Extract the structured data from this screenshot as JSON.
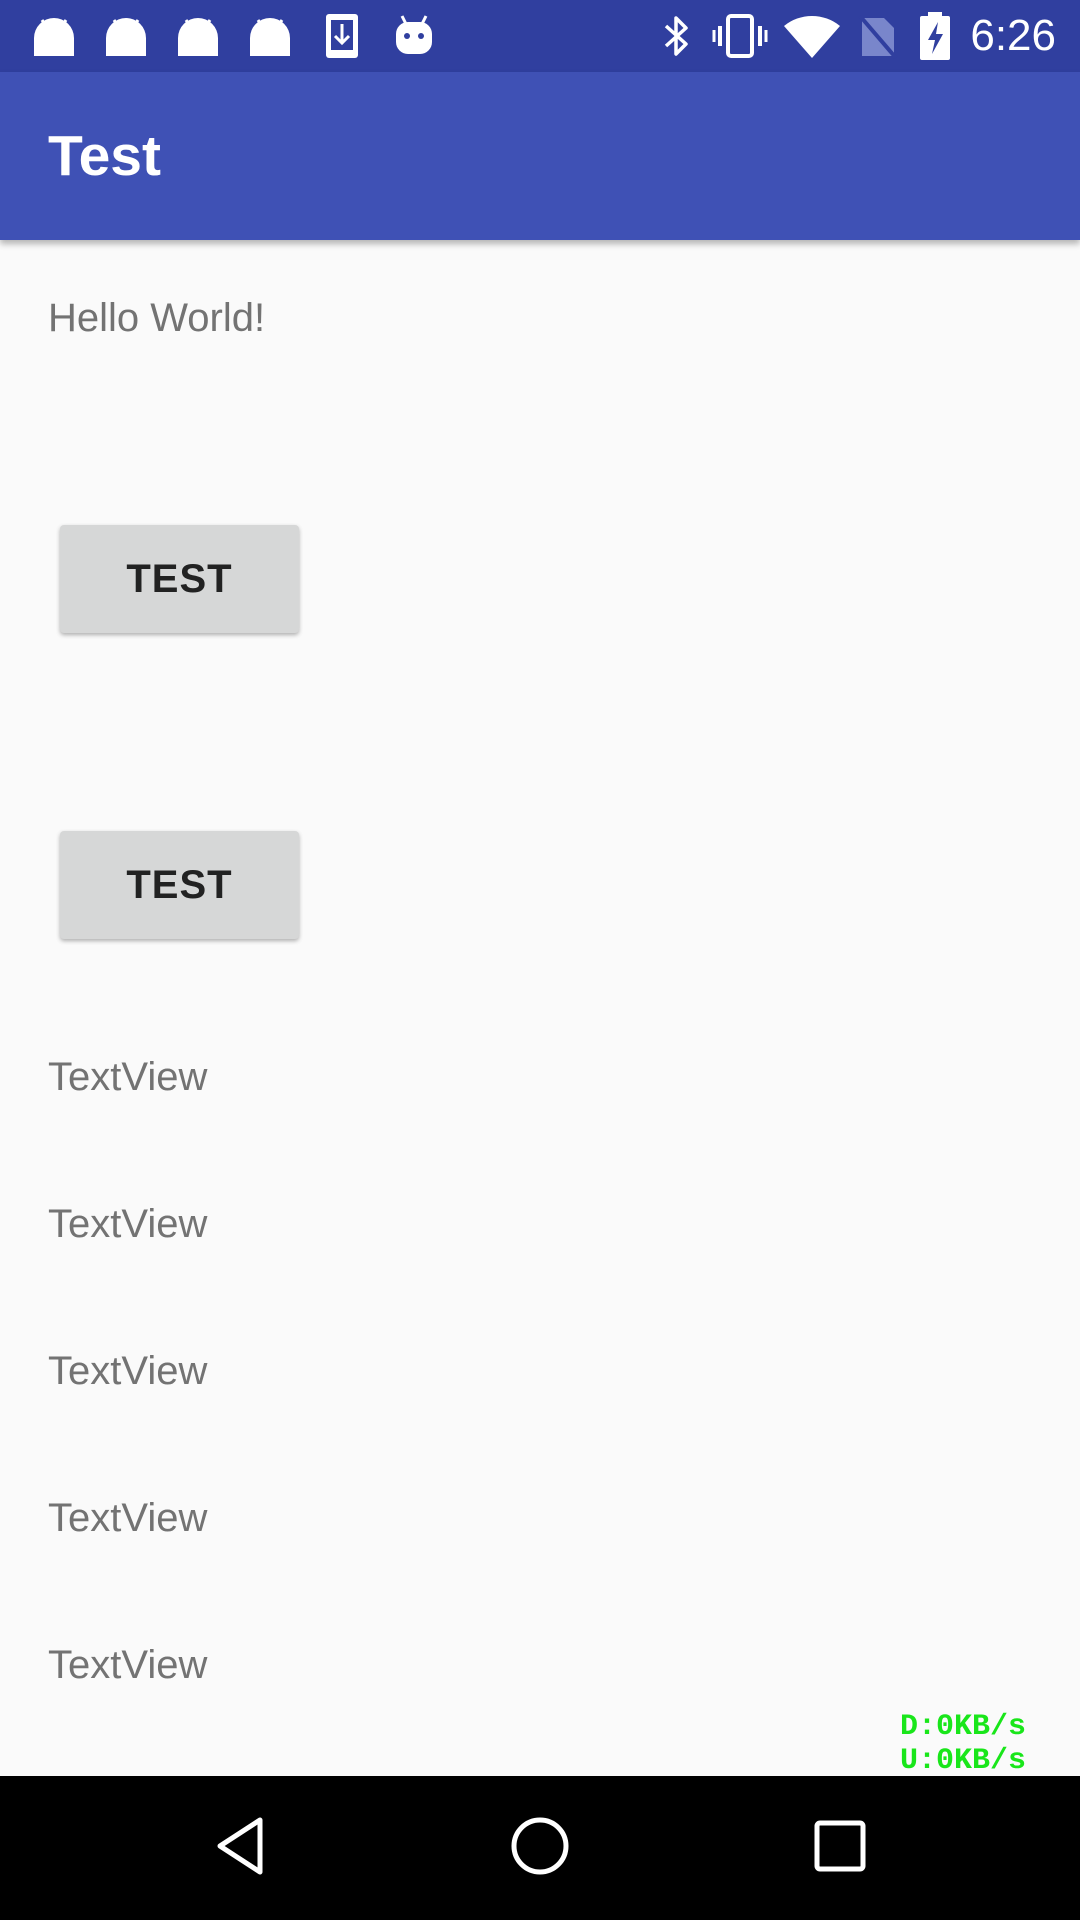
{
  "status_bar": {
    "time": "6:26",
    "left_icons": [
      "android-icon",
      "android-icon",
      "android-icon",
      "android-icon",
      "download-icon",
      "android-head-icon"
    ],
    "right_icons": [
      "bluetooth-icon",
      "vibrate-icon",
      "wifi-icon",
      "no-sim-icon",
      "battery-charging-icon"
    ],
    "background": "#303f9f"
  },
  "app_bar": {
    "title": "Test",
    "background": "#3f51b5"
  },
  "content": {
    "hello_text": "Hello World!",
    "button_1_label": "TEST",
    "button_2_label": "TEST",
    "text_views": [
      "TextView",
      "TextView",
      "TextView",
      "TextView",
      "TextView"
    ]
  },
  "net_speed": {
    "download": "D:0KB/s",
    "upload": "U:0KB/s",
    "color": "#19e61a"
  },
  "nav_bar": {
    "icons": [
      "back-icon",
      "home-icon",
      "recents-icon"
    ]
  }
}
